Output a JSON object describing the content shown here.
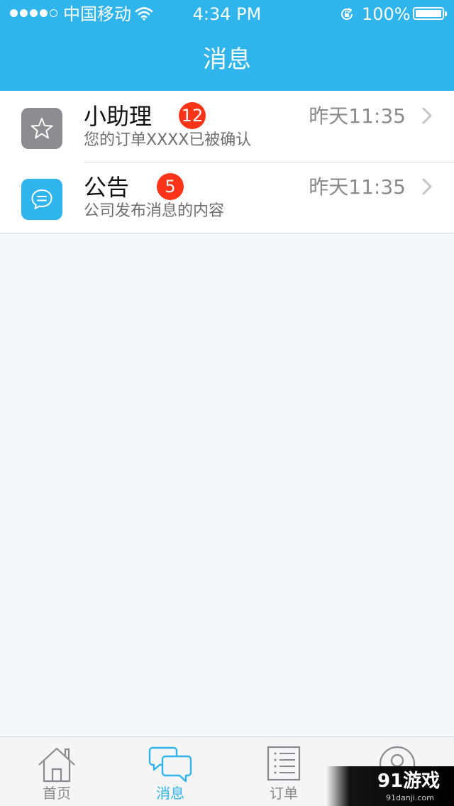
{
  "status_bar": {
    "carrier": "中国移动",
    "time": "4:34 PM",
    "battery": "100%",
    "icons": [
      "signal-dots-icon",
      "wifi-icon",
      "rotation-lock-icon",
      "battery-icon"
    ]
  },
  "nav": {
    "title": "消息"
  },
  "messages": [
    {
      "title": "小助理",
      "badge": "12",
      "time": "昨天11:35",
      "preview": "您的订单XXXX已被确认",
      "icon": "star-icon",
      "icon_color": "#8c8c91"
    },
    {
      "title": "公告",
      "badge": "5",
      "time": "昨天11:35",
      "preview": "公司发布消息的内容",
      "icon": "chat-bubble-icon",
      "icon_color": "#2fb4ec"
    }
  ],
  "tabs": [
    {
      "label": "首页",
      "icon": "home-icon",
      "active": false
    },
    {
      "label": "消息",
      "icon": "messages-icon",
      "active": true
    },
    {
      "label": "订单",
      "icon": "order-list-icon",
      "active": false
    },
    {
      "label": "",
      "icon": "profile-icon",
      "active": false
    }
  ],
  "watermark": {
    "main": "91游戏",
    "sub": "91danji.com"
  },
  "colors": {
    "accent": "#2fb4ec",
    "badge": "#ff3318",
    "background": "#f6f7f9"
  }
}
